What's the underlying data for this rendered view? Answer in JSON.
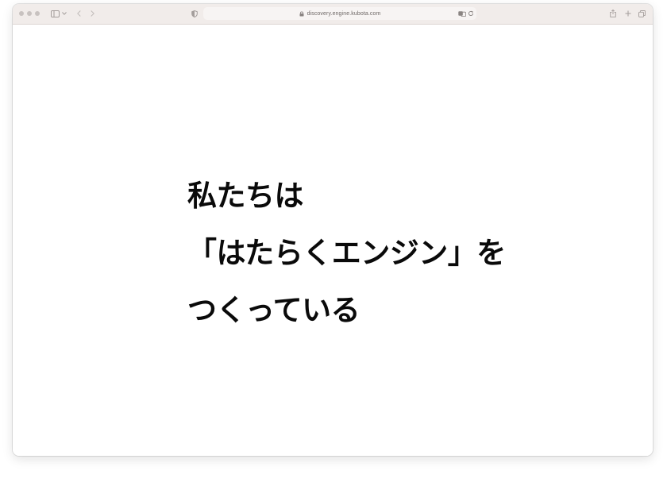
{
  "browser": {
    "url": "discovery.engine.kubota.com",
    "icons": {
      "traffic_lights": [
        "close-dot",
        "minimize-dot",
        "zoom-dot"
      ],
      "sidebar": "sidebar-icon",
      "sidebar_menu": "chevron-down-icon",
      "back": "chevron-left-icon",
      "forward": "chevron-right-icon",
      "privacy": "shield-icon",
      "lock": "lock-icon",
      "translate": "translate-icon",
      "reload": "reload-icon",
      "share": "share-icon",
      "new_tab": "plus-icon",
      "tabs": "tabs-overview-icon"
    },
    "colors": {
      "toolbar": "#f1ecea",
      "url_field": "#f7f4f3",
      "icon": "#a39d9b"
    }
  },
  "page": {
    "headline": {
      "line1": "私たちは",
      "line2": "「はたらくエンジン」を",
      "line3": "つくっている"
    },
    "colors": {
      "background": "#ffffff",
      "text": "#0a0a0a"
    }
  }
}
